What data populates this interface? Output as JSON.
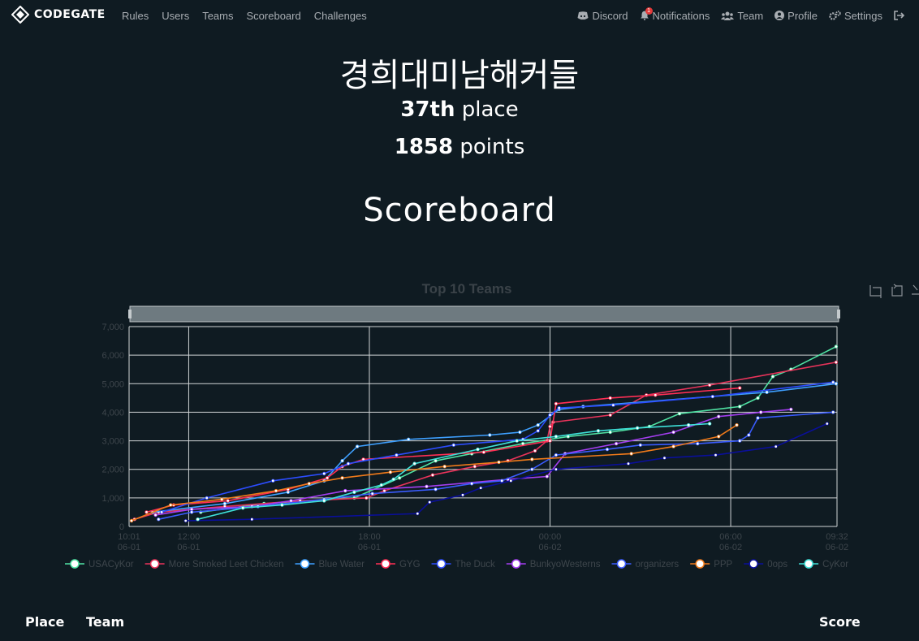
{
  "nav": {
    "brand": "CODEGATE",
    "left": [
      "Rules",
      "Users",
      "Teams",
      "Scoreboard",
      "Challenges"
    ],
    "discord": "Discord",
    "notifications": "Notifications",
    "notif_badge": "1",
    "team": "Team",
    "profile": "Profile",
    "settings": "Settings"
  },
  "team": {
    "name": "경희대미남해커들",
    "place_num": "37th",
    "place_word": "place",
    "points_num": "1858",
    "points_word": "points"
  },
  "scoreboard_title": "Scoreboard",
  "table_headers": {
    "place": "Place",
    "team": "Team",
    "score": "Score"
  },
  "chart_data": {
    "type": "line",
    "title": "Top 10 Teams",
    "ylim": [
      0,
      7000
    ],
    "yticks": [
      "0",
      "1,000",
      "2,000",
      "3,000",
      "4,000",
      "5,000",
      "6,000",
      "7,000"
    ],
    "x_range_hours": [
      10.02,
      33.53
    ],
    "xticks": [
      {
        "time": "10:01",
        "date": "06-01",
        "h": 10.02
      },
      {
        "time": "12:00",
        "date": "06-01",
        "h": 12
      },
      {
        "time": "18:00",
        "date": "06-01",
        "h": 18
      },
      {
        "time": "00:00",
        "date": "06-02",
        "h": 24
      },
      {
        "time": "06:00",
        "date": "06-02",
        "h": 30
      },
      {
        "time": "09:32",
        "date": "06-02",
        "h": 33.53
      }
    ],
    "grid": true,
    "legend_position": "bottom",
    "series": [
      {
        "name": "USACyKor",
        "color": "#50e3a4",
        "points": [
          [
            12.4,
            500
          ],
          [
            14.5,
            800
          ],
          [
            17.5,
            1000
          ],
          [
            19.0,
            1700
          ],
          [
            20.2,
            2300
          ],
          [
            21.4,
            2550
          ],
          [
            23.1,
            2900
          ],
          [
            24.6,
            3150
          ],
          [
            26.0,
            3300
          ],
          [
            27.3,
            3500
          ],
          [
            28.3,
            3950
          ],
          [
            30.3,
            4200
          ],
          [
            30.9,
            4500
          ],
          [
            31.4,
            5250
          ],
          [
            32.0,
            5500
          ],
          [
            33.5,
            6300
          ]
        ]
      },
      {
        "name": "More Smoked Leet Chicken",
        "color": "#e8335a",
        "points": [
          [
            10.2,
            250
          ],
          [
            11.0,
            500
          ],
          [
            13.2,
            700
          ],
          [
            15.7,
            900
          ],
          [
            17.9,
            1000
          ],
          [
            18.5,
            1250
          ],
          [
            20.1,
            1800
          ],
          [
            21.5,
            2100
          ],
          [
            22.6,
            2300
          ],
          [
            23.5,
            2650
          ],
          [
            23.9,
            3000
          ],
          [
            24.0,
            3500
          ],
          [
            24.1,
            3650
          ],
          [
            26.0,
            3900
          ],
          [
            27.2,
            4600
          ],
          [
            29.3,
            4950
          ],
          [
            33.5,
            5750
          ]
        ]
      },
      {
        "name": "Blue Water",
        "color": "#3ea0ff",
        "points": [
          [
            10.8,
            500
          ],
          [
            13.2,
            800
          ],
          [
            15.3,
            1200
          ],
          [
            16.5,
            1600
          ],
          [
            17.1,
            2300
          ],
          [
            17.6,
            2800
          ],
          [
            19.3,
            3050
          ],
          [
            22.0,
            3200
          ],
          [
            23.0,
            3300
          ],
          [
            23.6,
            3550
          ],
          [
            24.3,
            4100
          ],
          [
            25.1,
            4200
          ],
          [
            31.2,
            4700
          ],
          [
            33.5,
            5000
          ]
        ]
      },
      {
        "name": "GYG",
        "color": "#ff2f55",
        "points": [
          [
            10.6,
            500
          ],
          [
            11.5,
            750
          ],
          [
            13.3,
            900
          ],
          [
            15.3,
            1300
          ],
          [
            16.6,
            1700
          ],
          [
            17.1,
            2100
          ],
          [
            17.8,
            2350
          ],
          [
            21.8,
            2600
          ],
          [
            24.0,
            3000
          ],
          [
            24.2,
            4300
          ],
          [
            26.0,
            4500
          ],
          [
            27.5,
            4600
          ],
          [
            30.3,
            4850
          ]
        ]
      },
      {
        "name": "The Duck",
        "color": "#2c4dff",
        "points": [
          [
            11.1,
            500
          ],
          [
            12.6,
            1000
          ],
          [
            14.8,
            1600
          ],
          [
            16.5,
            1850
          ],
          [
            17.3,
            2200
          ],
          [
            18.9,
            2500
          ],
          [
            20.8,
            2850
          ],
          [
            23.1,
            3050
          ],
          [
            23.6,
            3350
          ],
          [
            24.0,
            3900
          ],
          [
            24.3,
            4150
          ],
          [
            26.1,
            4250
          ],
          [
            29.4,
            4550
          ],
          [
            33.4,
            5050
          ]
        ]
      },
      {
        "name": "BunkyoWesterns",
        "color": "#a43ef0",
        "points": [
          [
            10.9,
            400
          ],
          [
            12.1,
            600
          ],
          [
            14.1,
            700
          ],
          [
            15.4,
            900
          ],
          [
            17.2,
            1250
          ],
          [
            19.9,
            1400
          ],
          [
            22.6,
            1650
          ],
          [
            23.9,
            1750
          ],
          [
            24.5,
            2550
          ],
          [
            26.2,
            2900
          ],
          [
            28.1,
            3300
          ],
          [
            29.6,
            3850
          ],
          [
            31.0,
            4000
          ],
          [
            32.0,
            4100
          ]
        ]
      },
      {
        "name": "organizers",
        "color": "#3a5cff",
        "points": [
          [
            11.0,
            250
          ],
          [
            12.1,
            500
          ],
          [
            14.3,
            700
          ],
          [
            16.5,
            950
          ],
          [
            18.1,
            1150
          ],
          [
            20.2,
            1300
          ],
          [
            21.4,
            1500
          ],
          [
            22.4,
            1600
          ],
          [
            23.4,
            2000
          ],
          [
            24.2,
            2500
          ],
          [
            25.9,
            2700
          ],
          [
            27.0,
            2850
          ],
          [
            28.9,
            2900
          ],
          [
            30.3,
            3000
          ],
          [
            30.6,
            3200
          ],
          [
            30.9,
            3800
          ],
          [
            33.4,
            4000
          ]
        ]
      },
      {
        "name": "PPP",
        "color": "#f07a1a",
        "points": [
          [
            10.1,
            200
          ],
          [
            11.4,
            750
          ],
          [
            13.1,
            950
          ],
          [
            14.9,
            1250
          ],
          [
            16.0,
            1500
          ],
          [
            17.1,
            1700
          ],
          [
            18.7,
            1900
          ],
          [
            20.5,
            2100
          ],
          [
            22.3,
            2250
          ],
          [
            23.4,
            2350
          ],
          [
            26.7,
            2550
          ],
          [
            28.1,
            2800
          ],
          [
            29.6,
            3150
          ],
          [
            30.2,
            3550
          ]
        ]
      },
      {
        "name": "0ops",
        "color": "#0a0f9a",
        "points": [
          [
            11.9,
            200
          ],
          [
            14.1,
            250
          ],
          [
            19.6,
            450
          ],
          [
            20.0,
            850
          ],
          [
            21.1,
            1100
          ],
          [
            21.7,
            1350
          ],
          [
            22.7,
            1600
          ],
          [
            24.2,
            2000
          ],
          [
            26.6,
            2200
          ],
          [
            27.8,
            2400
          ],
          [
            29.5,
            2500
          ],
          [
            31.5,
            2800
          ],
          [
            33.2,
            3600
          ]
        ]
      },
      {
        "name": "CyKor",
        "color": "#3ee0d8",
        "points": [
          [
            12.3,
            250
          ],
          [
            13.8,
            650
          ],
          [
            15.1,
            750
          ],
          [
            16.5,
            900
          ],
          [
            17.5,
            1200
          ],
          [
            18.4,
            1450
          ],
          [
            18.8,
            1650
          ],
          [
            19.5,
            2200
          ],
          [
            21.6,
            2700
          ],
          [
            22.9,
            3000
          ],
          [
            24.2,
            3150
          ],
          [
            25.6,
            3350
          ],
          [
            26.9,
            3450
          ],
          [
            28.6,
            3550
          ],
          [
            29.3,
            3600
          ]
        ]
      }
    ]
  }
}
